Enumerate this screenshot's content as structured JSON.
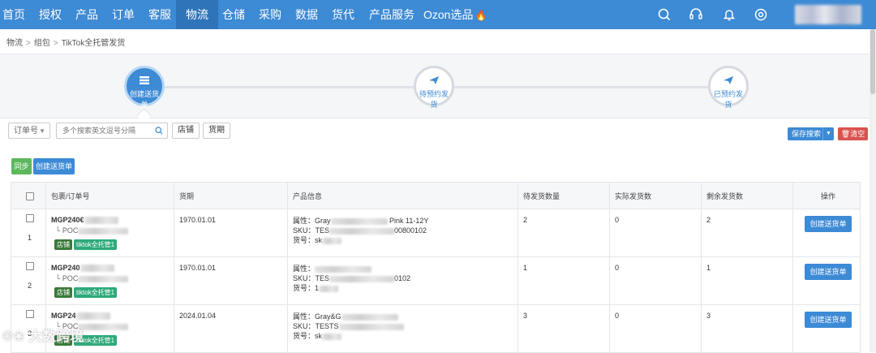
{
  "nav": {
    "items": [
      "首页",
      "授权",
      "产品",
      "订单",
      "客服",
      "物流",
      "仓储",
      "采购",
      "数据",
      "货代",
      "产品服务",
      "Ozon选品"
    ],
    "active": "物流",
    "icons": [
      "search-icon",
      "headset-icon",
      "bell-icon",
      "gear-icon"
    ]
  },
  "breadcrumb": [
    "物流",
    "组包",
    "TikTok全托管发货"
  ],
  "steps": [
    {
      "label": "创建送货单",
      "active": true
    },
    {
      "label": "待预约发货",
      "active": false
    },
    {
      "label": "已预约发货",
      "active": false
    }
  ],
  "filters": {
    "select_value": "订单号",
    "search_placeholder": "多个搜索英文逗号分隔",
    "shop_btn": "店铺",
    "date_btn": "货期",
    "save_search": "保存搜索",
    "clear": "清空"
  },
  "actions": {
    "sync": "同步",
    "create": "创建送货单"
  },
  "table": {
    "headers": [
      "包裹/订单号",
      "货期",
      "产品信息",
      "待发货数量",
      "实际发货数",
      "剩余发货数",
      "操作"
    ],
    "rows": [
      {
        "index": "1",
        "order_prefix": "MGP240€",
        "sub_prefix": "POC",
        "date": "1970.01.01",
        "attr": "属性：Gray",
        "attr_tail": "Pink 11-12Y",
        "sku": "SKU：TES",
        "sku_tail": "00800102",
        "item_no": "货号：sk",
        "pending": "2",
        "actual": "0",
        "remaining": "2",
        "tag_shop": "店铺",
        "tag_tk": "tiktok全托管1",
        "btn": "创建送货单"
      },
      {
        "index": "2",
        "order_prefix": "MGP240",
        "sub_prefix": "POC",
        "date": "1970.01.01",
        "attr": "属性：",
        "attr_tail": "",
        "sku": "SKU：TES",
        "sku_tail": "0102",
        "item_no": "货号：1",
        "pending": "1",
        "actual": "0",
        "remaining": "1",
        "tag_shop": "店铺",
        "tag_tk": "tiktok全托管1",
        "btn": "创建送货单"
      },
      {
        "index": "3",
        "order_prefix": "MGP24",
        "sub_prefix": "POC",
        "date": "2024.01.04",
        "attr": "属性：Gray&G",
        "attr_tail": "",
        "sku": "SKU：TESTS",
        "sku_tail": "",
        "item_no": "货号：sk",
        "pending": "3",
        "actual": "0",
        "remaining": "3",
        "tag_shop": "店铺",
        "tag_tk": "tiktok全托管1",
        "btn": "创建送货单"
      }
    ]
  }
}
